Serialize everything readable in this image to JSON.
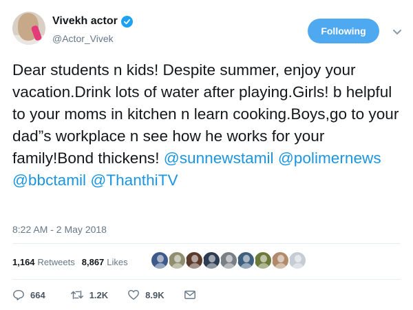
{
  "author": {
    "display_name": "Vivekh actor",
    "handle": "@Actor_Vivek",
    "verified": true
  },
  "follow_button": {
    "label": "Following",
    "color": "#4ea9f0"
  },
  "tweet": {
    "text": "Dear students n kids! Despite summer, enjoy your vacation.Drink lots of water after playing.Girls! b helpful to your moms in kitchen n learn cooking.Boys,go to your dad”s workplace n see how he works for your family!Bond thickens! ",
    "mentions": [
      "@sunnewstamil",
      "@polimernews",
      "@bbctamil",
      "@ThanthiTV"
    ],
    "timestamp": "8:22 AM - 2 May 2018"
  },
  "stats": {
    "retweets_count": "1,164",
    "retweets_label": "Retweets",
    "likes_count": "8,867",
    "likes_label": "Likes"
  },
  "likers": [
    {
      "icon": "avatar-icon",
      "color": "#3e5a8a"
    },
    {
      "icon": "avatar-icon",
      "color": "#8f8f70"
    },
    {
      "icon": "avatar-icon",
      "color": "#5a3a2a"
    },
    {
      "icon": "avatar-icon",
      "color": "#2e3c52"
    },
    {
      "icon": "avatar-icon",
      "color": "#7a7f86"
    },
    {
      "icon": "avatar-icon",
      "color": "#3f5f7f"
    },
    {
      "icon": "avatar-icon",
      "color": "#6b7a3a"
    },
    {
      "icon": "avatar-icon",
      "color": "#b08a6a"
    },
    {
      "icon": "avatar-icon",
      "color": "#c5ccd3"
    }
  ],
  "actions": {
    "replies": "664",
    "retweets": "1.2K",
    "likes": "8.9K"
  },
  "colors": {
    "link": "#1b95e0",
    "muted": "#657786",
    "verified": "#1da1f2"
  }
}
